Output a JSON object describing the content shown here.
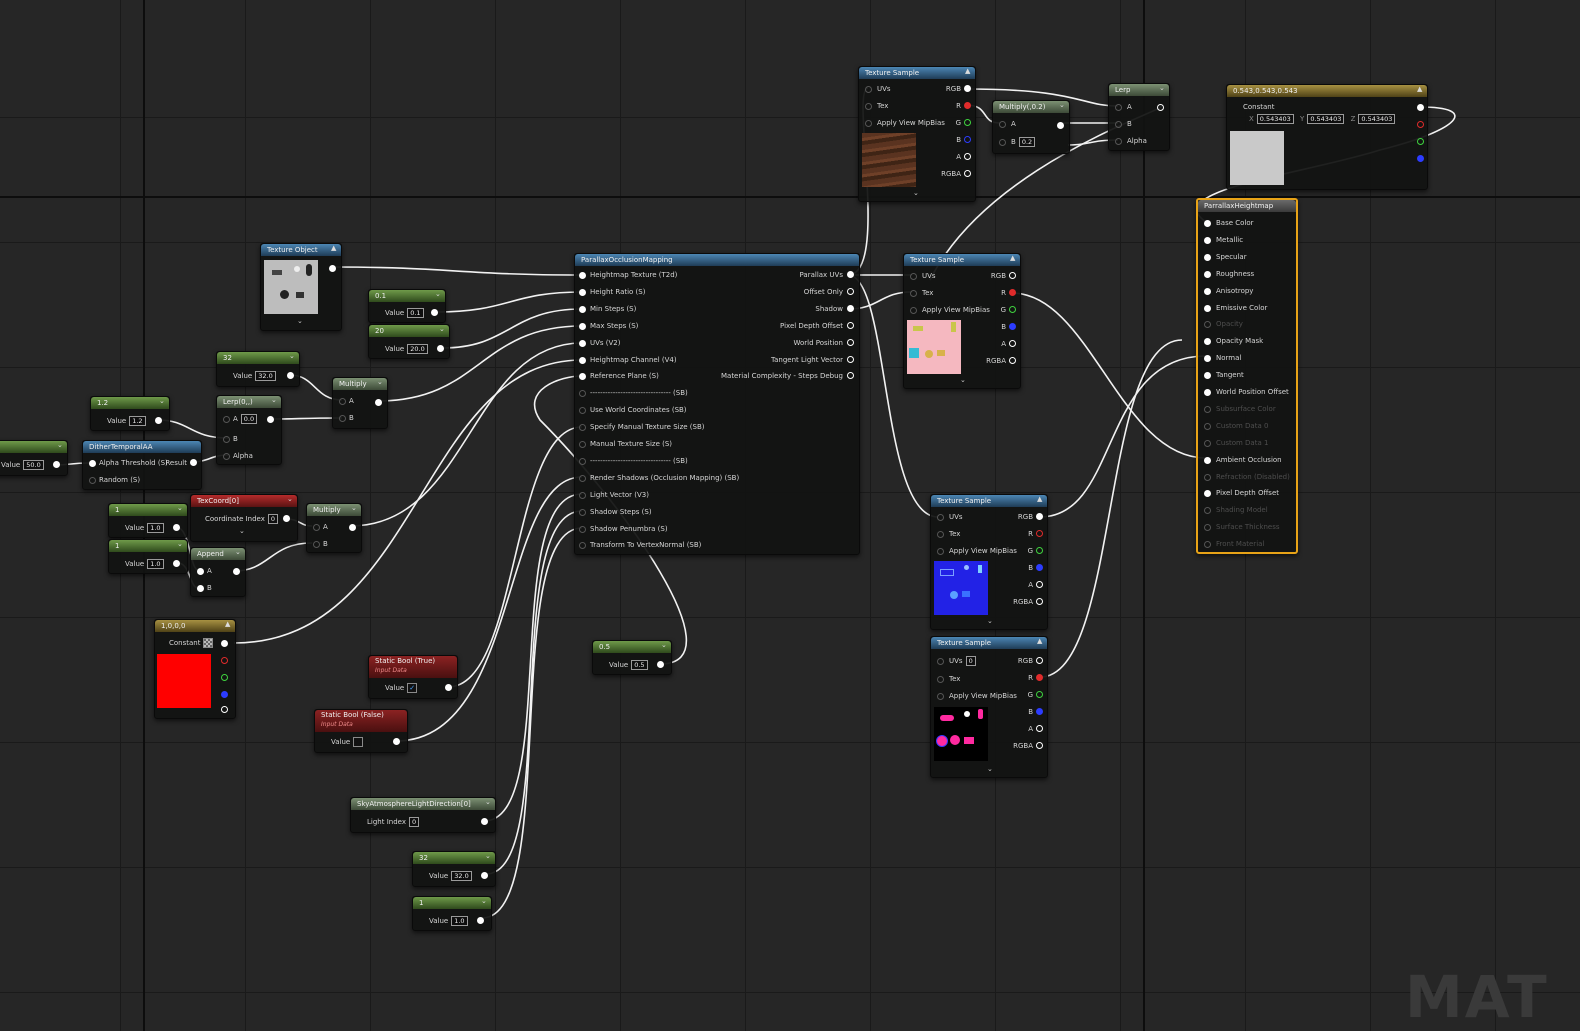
{
  "watermark": "MAT",
  "colors": {
    "background": "#262626",
    "wire": "#ffffff",
    "selected_outline": "#e8a317"
  },
  "nodes": {
    "ts_top": {
      "title": "Texture Sample",
      "uvs": "UVs",
      "tex": "Tex",
      "mip": "Apply View MipBias",
      "rgb": "RGB",
      "r": "R",
      "g": "G",
      "b": "B",
      "a": "A",
      "rgba": "RGBA"
    },
    "multiply02": {
      "title": "Multiply(,0.2)",
      "a": "A",
      "b": "B",
      "b_value": "0.2"
    },
    "lerp_top": {
      "title": "Lerp",
      "a": "A",
      "b": "B",
      "alpha": "Alpha"
    },
    "const3": {
      "title": "0.543,0.543,0.543",
      "constant": "Constant",
      "x_label": "X",
      "y_label": "Y",
      "z_label": "Z",
      "x": "0.543403",
      "y": "0.543403",
      "z": "0.543403"
    },
    "material": {
      "title": "ParrallaxHeightmap",
      "inputs": [
        "Base Color",
        "Metallic",
        "Specular",
        "Roughness",
        "Anisotropy",
        "Emissive Color",
        "Opacity",
        "Opacity Mask",
        "Normal",
        "Tangent",
        "World Position Offset",
        "Subsurface Color",
        "Custom Data 0",
        "Custom Data 1",
        "Ambient Occlusion",
        "Refraction (Disabled)",
        "Pixel Depth Offset",
        "Shading Model",
        "Surface Thickness",
        "Front Material"
      ],
      "enabled": [
        true,
        true,
        true,
        true,
        true,
        true,
        false,
        true,
        true,
        true,
        true,
        false,
        false,
        false,
        true,
        false,
        true,
        false,
        false,
        false
      ]
    },
    "tex_object": {
      "title": "Texture Object"
    },
    "pom": {
      "title": "ParallaxOcclusionMapping",
      "inputs": [
        "Heightmap Texture (T2d)",
        "Height Ratio (S)",
        "Min Steps (S)",
        "Max Steps (S)",
        "UVs (V2)",
        "Heightmap Channel (V4)",
        "Reference Plane (S)",
        "-------------------------------- (SB)",
        "Use World Coordinates (SB)",
        "Specify Manual Texture Size (SB)",
        "Manual Texture Size (S)",
        "-------------------------------- (SB)",
        "Render Shadows (Occlusion Mapping) (SB)",
        "Light Vector (V3)",
        "Shadow Steps (S)",
        "Shadow Penumbra (S)",
        "Transform To VertexNormal (SB)"
      ],
      "outputs": [
        "Parallax UVs",
        "Offset Only",
        "Shadow",
        "Pixel Depth Offset",
        "World Position",
        "Tangent Light Vector",
        "Material Complexity - Steps Debug"
      ]
    },
    "ts_mid": {
      "title": "Texture Sample",
      "uvs": "UVs",
      "tex": "Tex",
      "mip": "Apply View MipBias",
      "rgb": "RGB",
      "r": "R",
      "g": "G",
      "b": "B",
      "a": "A",
      "rgba": "RGBA"
    },
    "ts_normal": {
      "title": "Texture Sample",
      "uvs": "UVs",
      "tex": "Tex",
      "mip": "Apply View MipBias",
      "rgb": "RGB",
      "r": "R",
      "g": "G",
      "b": "B",
      "a": "A",
      "rgba": "RGBA"
    },
    "ts_ao": {
      "title": "Texture Sample",
      "uvs": "UVs",
      "uvs_value": "0",
      "tex": "Tex",
      "mip": "Apply View MipBias",
      "rgb": "RGB",
      "r": "R",
      "g": "G",
      "b": "B",
      "a": "A",
      "rgba": "RGBA"
    },
    "c01": {
      "title": "0.1",
      "label": "Value",
      "value": "0.1"
    },
    "c20": {
      "title": "20",
      "label": "Value",
      "value": "20.0"
    },
    "c32a": {
      "title": "32",
      "label": "Value",
      "value": "32.0"
    },
    "c12": {
      "title": "1.2",
      "label": "Value",
      "value": "1.2"
    },
    "lerp0": {
      "title": "Lerp(0,,)",
      "a": "A",
      "a_value": "0.0",
      "b": "B",
      "alpha": "Alpha"
    },
    "multiply_a": {
      "title": "Multiply",
      "a": "A",
      "b": "B"
    },
    "c50": {
      "label": "Value",
      "value": "50.0"
    },
    "dither": {
      "title": "DitherTemporalAA",
      "alpha": "Alpha Threshold (S)",
      "result": "Result",
      "random": "Random (S)"
    },
    "c1a": {
      "title": "1",
      "label": "Value",
      "value": "1.0"
    },
    "c1b": {
      "title": "1",
      "label": "Value",
      "value": "1.0"
    },
    "texcoord": {
      "title": "TexCoord[0]",
      "label": "Coordinate Index",
      "value": "0"
    },
    "append": {
      "title": "Append",
      "a": "A",
      "b": "B"
    },
    "multiply_b": {
      "title": "Multiply",
      "a": "A",
      "b": "B"
    },
    "c_red": {
      "title": "1,0,0,0",
      "label": "Constant"
    },
    "sb_true": {
      "title": "Static Bool (True)",
      "sub": "Input Data",
      "label": "Value"
    },
    "sb_false": {
      "title": "Static Bool (False)",
      "sub": "Input Data",
      "label": "Value"
    },
    "c05": {
      "title": "0.5",
      "label": "Value",
      "value": "0.5"
    },
    "sky": {
      "title": "SkyAtmosphereLightDirection[0]",
      "label": "Light Index",
      "value": "0"
    },
    "c32b": {
      "title": "32",
      "label": "Value",
      "value": "32.0"
    },
    "c1c": {
      "title": "1",
      "label": "Value",
      "value": "1.0"
    }
  }
}
